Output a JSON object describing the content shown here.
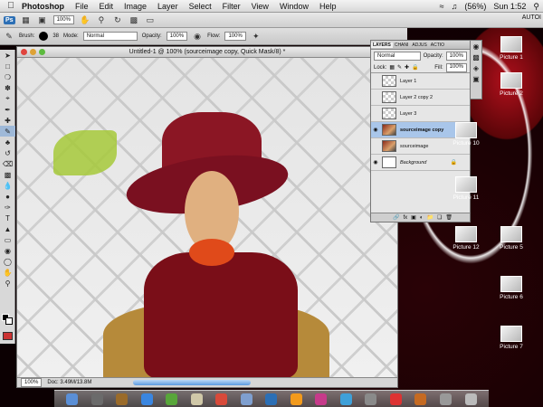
{
  "menubar": {
    "app": "Photoshop",
    "items": [
      "File",
      "Edit",
      "Image",
      "Layer",
      "Select",
      "Filter",
      "View",
      "Window",
      "Help"
    ],
    "battery": "(56%)",
    "clock": "Sun 1:52"
  },
  "appbar": {
    "zoom": "100%",
    "workspace": "AUTOI",
    "app_badge": "Ps"
  },
  "options": {
    "brush_label": "Brush:",
    "brush_size": "38",
    "mode_label": "Mode:",
    "mode_value": "Normal",
    "opacity_label": "Opacity:",
    "opacity_value": "100%",
    "flow_label": "Flow:",
    "flow_value": "100%"
  },
  "document": {
    "title": "Untitled-1 @ 100% (sourceimage copy, Quick Mask/8) *",
    "zoom": "100%",
    "doc_size": "Doc: 3.49M/13.8M"
  },
  "layers_panel": {
    "tabs": [
      "LAYERS",
      "CHANI",
      "ADJUS",
      "ACTIO"
    ],
    "blend_mode": "Normal",
    "opacity_label": "Opacity:",
    "opacity": "100%",
    "lock_label": "Lock:",
    "fill_label": "Fill:",
    "fill": "100%",
    "layers": [
      {
        "name": "Layer 1",
        "visible": false,
        "thumb": "transparent",
        "selected": false
      },
      {
        "name": "Layer 2 copy 2",
        "visible": false,
        "thumb": "transparent",
        "selected": false
      },
      {
        "name": "Layer 3",
        "visible": false,
        "thumb": "transparent",
        "selected": false
      },
      {
        "name": "sourceimage copy",
        "visible": true,
        "thumb": "image",
        "selected": true
      },
      {
        "name": "sourceimage",
        "visible": false,
        "thumb": "image",
        "selected": false
      },
      {
        "name": "Background",
        "visible": true,
        "thumb": "white",
        "selected": false
      }
    ]
  },
  "desktop_icons": [
    "Picture 1",
    "Picture 2",
    "Picture 10",
    "Picture 11",
    "Picture 12",
    "Picture 5",
    "Picture 6",
    "Picture 7"
  ],
  "colors": {
    "accent": "#2c6fb5",
    "quick_mask": "#cc3333",
    "dock_ai": "#f29a1c",
    "dock_br": "#c56a22"
  }
}
